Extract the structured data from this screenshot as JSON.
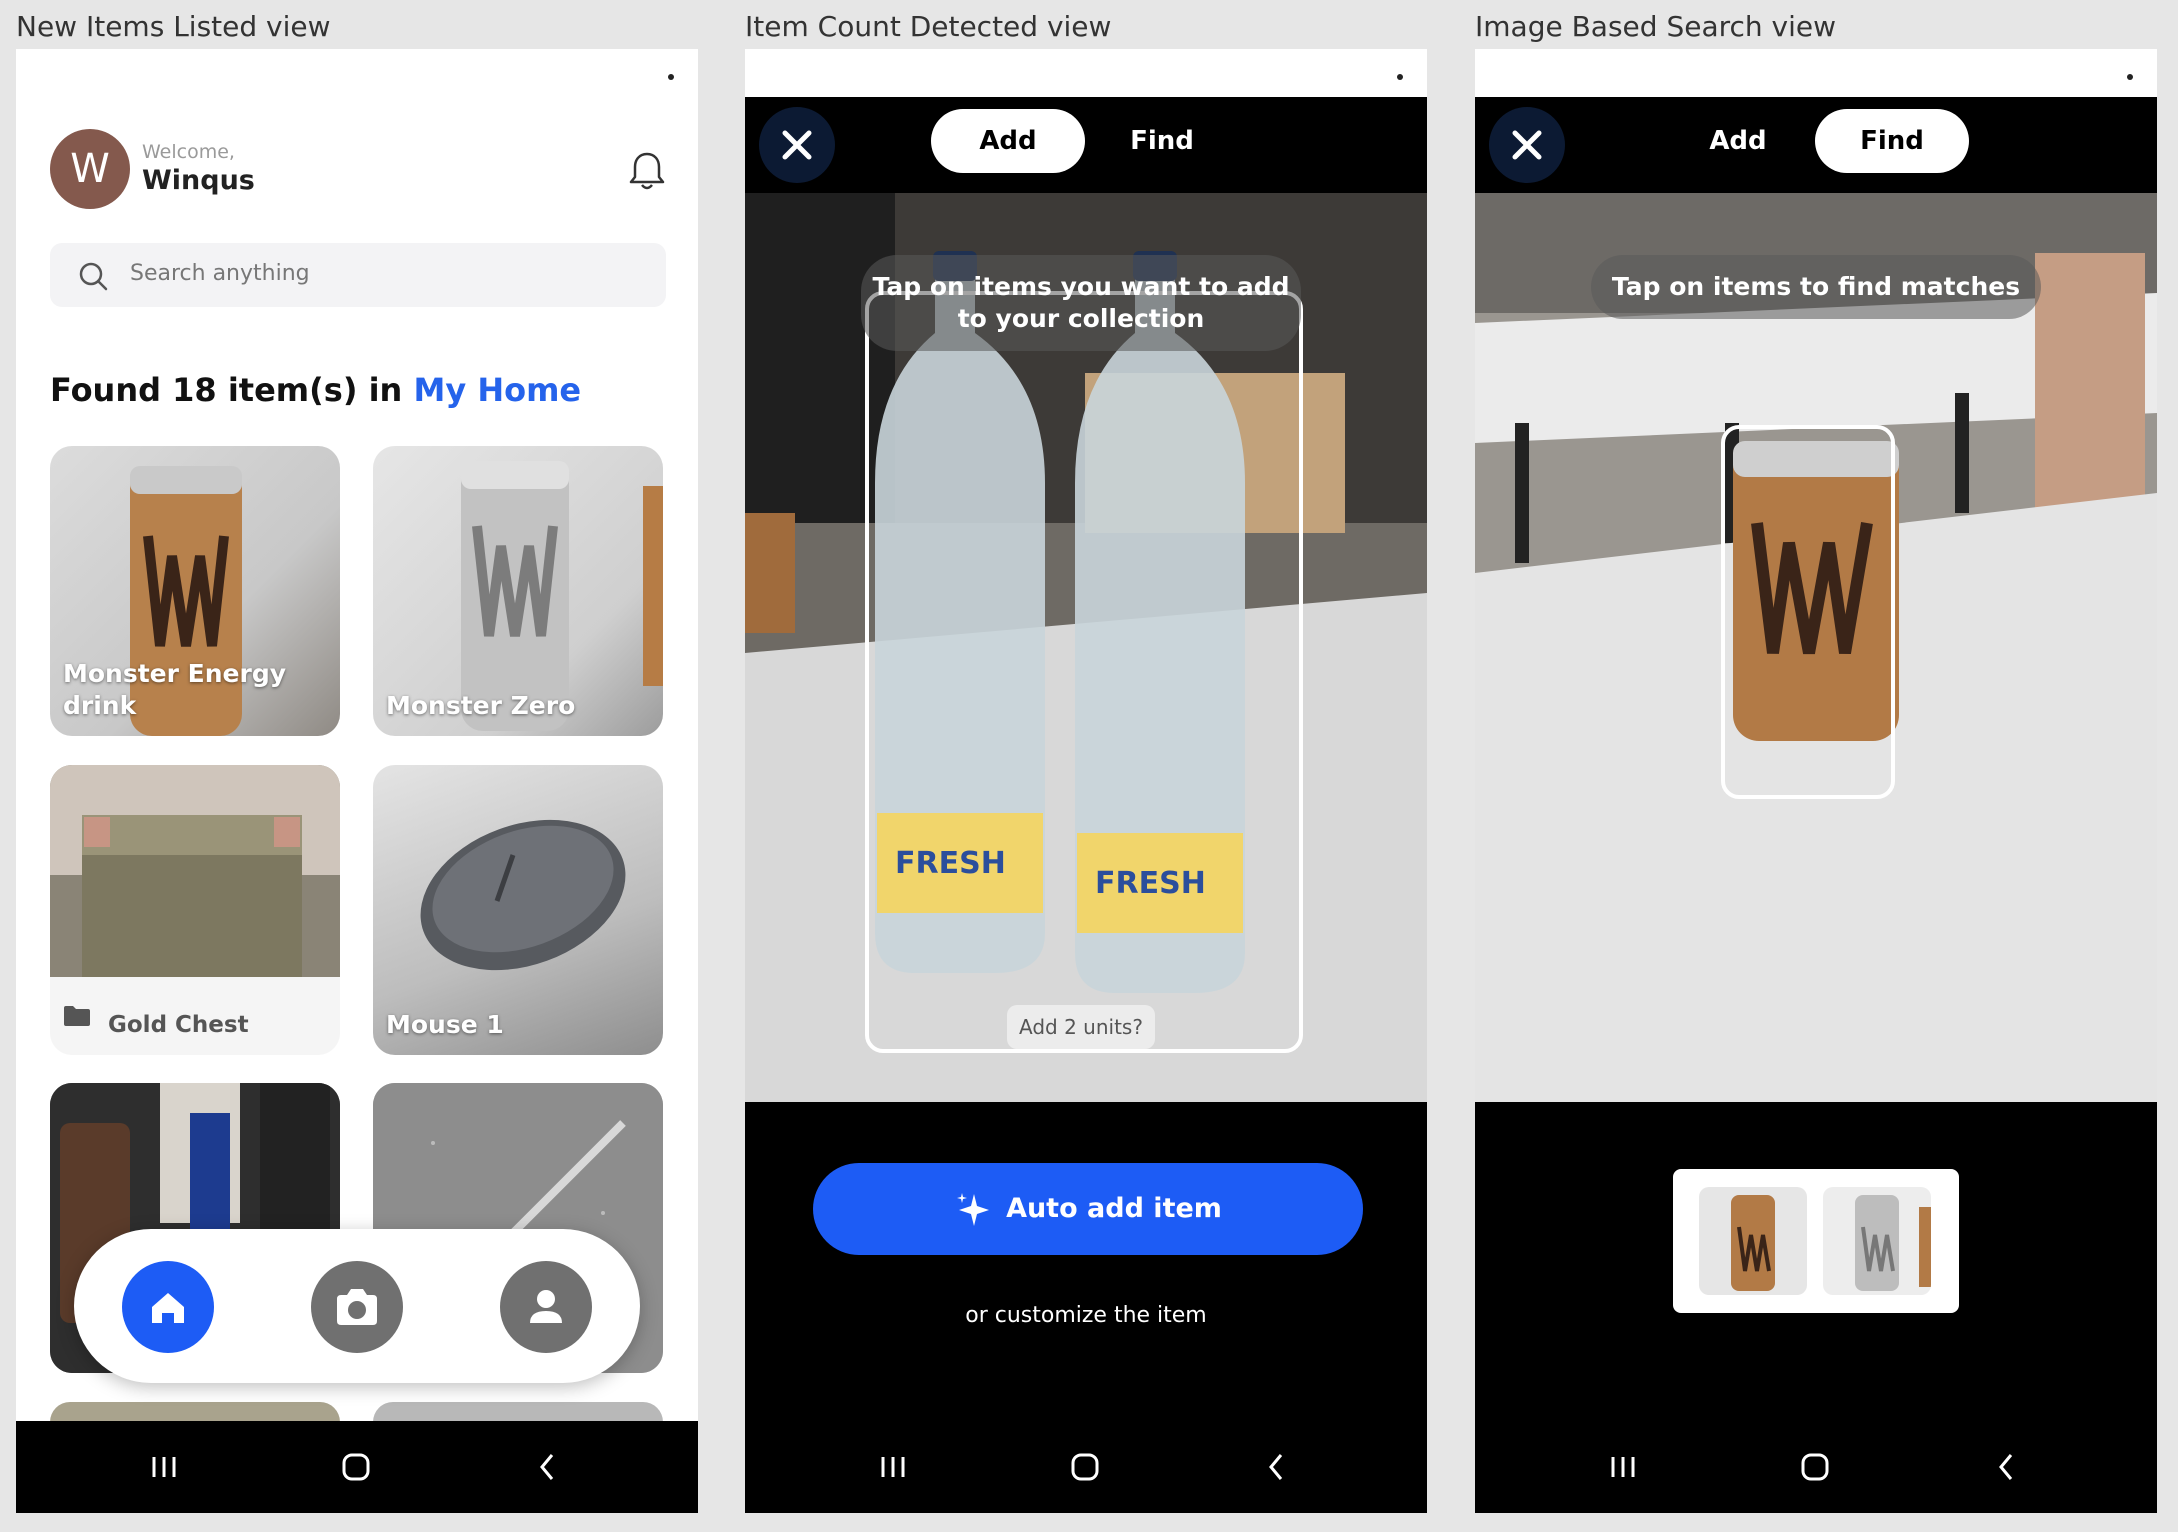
{
  "captions": {
    "view1": "New Items Listed view",
    "view2": "Item Count Detected view",
    "view3": "Image Based Search view"
  },
  "screen1": {
    "avatar_letter": "W",
    "welcome": "Welcome,",
    "username": "Winqus",
    "search_placeholder": "Search anything",
    "found_prefix": "Found 18 item(s) in",
    "found_location": "My Home",
    "items": [
      {
        "label": "Monster Energy drink"
      },
      {
        "label": "Monster Zero"
      },
      {
        "label": "Gold Chest",
        "icon": "folder-icon"
      },
      {
        "label": "Mouse 1"
      }
    ],
    "tabs": [
      "home-icon",
      "camera-icon",
      "profile-icon"
    ],
    "accent": "#2563eb"
  },
  "screen2": {
    "tab_add": "Add",
    "tab_find": "Find",
    "active_tab": "Add",
    "hint": "Tap on items you want to add to your collection",
    "add_units": "Add 2 units?",
    "cta": "Auto add item",
    "customize": "or customize the item",
    "accent": "#1d5cf5"
  },
  "screen3": {
    "tab_add": "Add",
    "tab_find": "Find",
    "active_tab": "Find",
    "hint": "Tap on items to find matches"
  }
}
